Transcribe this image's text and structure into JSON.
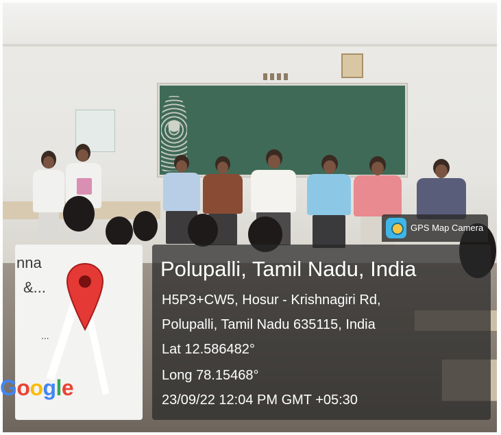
{
  "map_card": {
    "text_fragment_1": "nna",
    "text_fragment_2": "&...",
    "text_fragment_3": "...",
    "logo_text": "Google",
    "logo_letters": [
      {
        "ch": "G",
        "color": "#4285F4"
      },
      {
        "ch": "o",
        "color": "#EA4335"
      },
      {
        "ch": "o",
        "color": "#FBBC05"
      },
      {
        "ch": "g",
        "color": "#4285F4"
      },
      {
        "ch": "l",
        "color": "#34A853"
      },
      {
        "ch": "e",
        "color": "#EA4335"
      }
    ],
    "pin_color": "#E53935"
  },
  "badge": {
    "icon": "gps-map-camera-icon",
    "label": "GPS Map Camera"
  },
  "location": {
    "place": "Polupalli, Tamil Nadu, India",
    "address_line_1": "H5P3+CW5, Hosur - Krishnagiri Rd,",
    "address_line_2": "Polupalli, Tamil Nadu 635115, India",
    "lat": "Lat 12.586482°",
    "long": "Long 78.15468°",
    "datetime": "23/09/22 12:04 PM GMT +05:30"
  }
}
